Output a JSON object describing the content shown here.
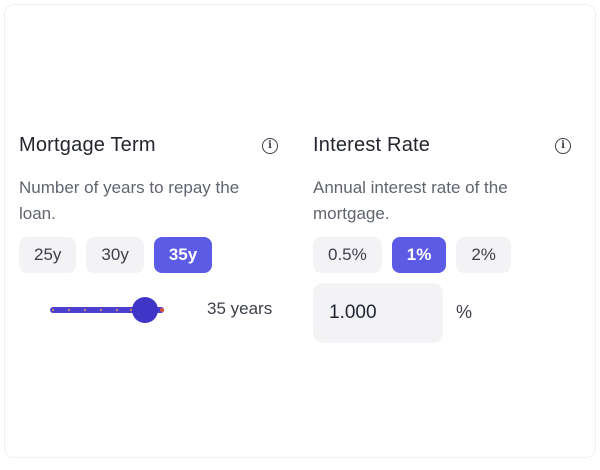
{
  "term": {
    "title": "Mortgage Term",
    "info_icon": "info-icon",
    "description": "Number of years to repay the loan.",
    "options": [
      {
        "label": "25y",
        "selected": false
      },
      {
        "label": "30y",
        "selected": false
      },
      {
        "label": "35y",
        "selected": true
      }
    ],
    "slider_value": 35,
    "value_text": "35 years"
  },
  "rate": {
    "title": "Interest Rate",
    "info_icon": "info-icon",
    "description": "Annual interest rate of the mortgage.",
    "options": [
      {
        "label": "0.5%",
        "selected": false
      },
      {
        "label": "1%",
        "selected": true
      },
      {
        "label": "2%",
        "selected": false
      }
    ],
    "input_value": "1.000",
    "unit": "%"
  },
  "colors": {
    "accent": "#5b5be6",
    "slider_track": "#4a3fcf",
    "chip_bg": "#f3f3f5"
  }
}
